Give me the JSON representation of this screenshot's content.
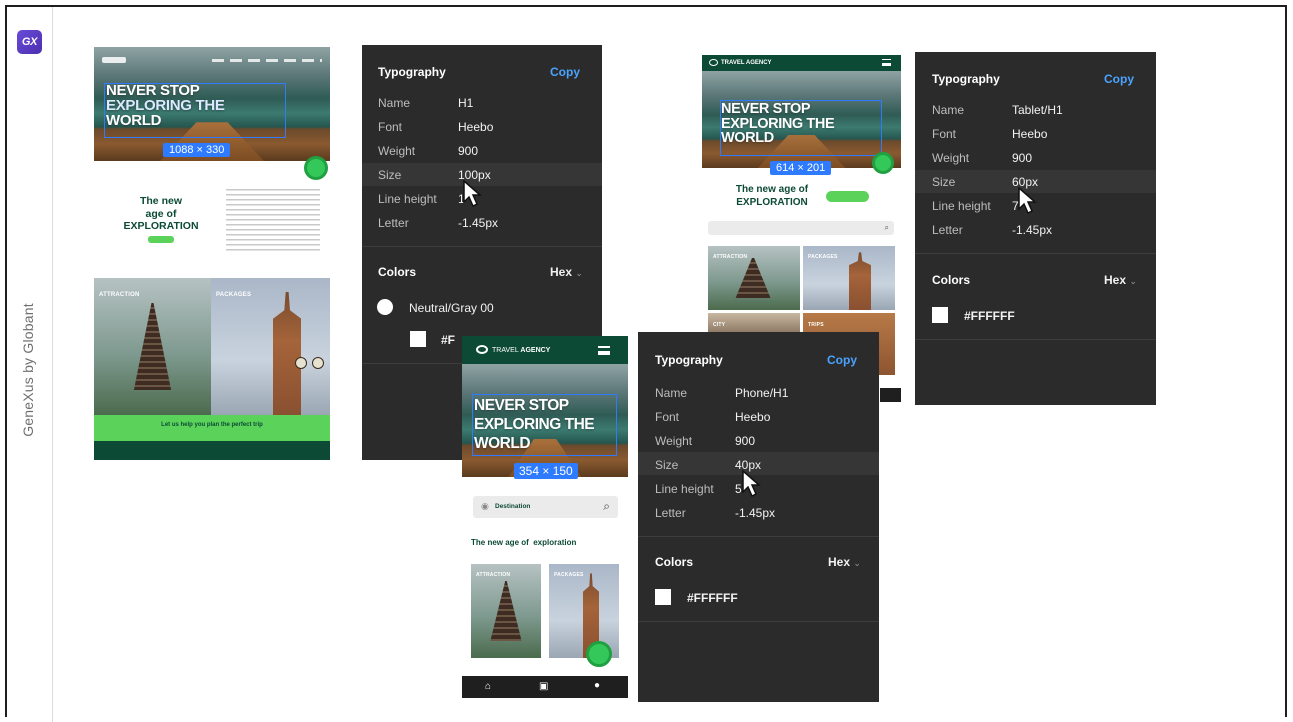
{
  "brand": {
    "logo_text": "GX",
    "vertical_label": "GeneXus by Globant"
  },
  "desktop_mock": {
    "hero_title_line1": "NEVER STOP",
    "hero_title_line2": "EXPLORING THE",
    "hero_title_line3": "WORLD",
    "dimension_badge": "1088 × 330",
    "section_title_line1": "The new",
    "section_title_line2": "age of",
    "section_title_line3": "EXPLORATION",
    "tile_attraction": "ATTRACTION",
    "tile_packages": "PACKAGES",
    "cta_banner": "Let us help you plan the perfect trip"
  },
  "desktop_inspector": {
    "section_typography": "Typography",
    "copy_label": "Copy",
    "rows": [
      {
        "label": "Name",
        "value": "H1"
      },
      {
        "label": "Font",
        "value": "Heebo"
      },
      {
        "label": "Weight",
        "value": "900"
      },
      {
        "label": "Size",
        "value": "100px"
      },
      {
        "label": "Line height",
        "value": "1"
      },
      {
        "label": "Letter",
        "value": "-1.45px"
      }
    ],
    "section_colors": "Colors",
    "format_label": "Hex",
    "color_token": "Neutral/Gray 00",
    "color_hex_partial": "#F"
  },
  "tablet_mock": {
    "app_name": "TRAVEL AGENCY",
    "hero_title_line1": "NEVER STOP",
    "hero_title_line2": "EXPLORING THE",
    "hero_title_line3": "WORLD",
    "dimension_badge": "614 × 201",
    "section_title_line1": "The new age of",
    "section_title_line2": "EXPLORATION",
    "tile_attraction": "ATTRACTION",
    "tile_packages": "PACKAGES",
    "tile_city": "CITY",
    "tile_trips": "TRIPS"
  },
  "tablet_inspector": {
    "section_typography": "Typography",
    "copy_label": "Copy",
    "rows": [
      {
        "label": "Name",
        "value": "Tablet/H1"
      },
      {
        "label": "Font",
        "value": "Heebo"
      },
      {
        "label": "Weight",
        "value": "900"
      },
      {
        "label": "Size",
        "value": "60px"
      },
      {
        "label": "Line height",
        "value": "7"
      },
      {
        "label": "Letter",
        "value": "-1.45px"
      }
    ],
    "section_colors": "Colors",
    "format_label": "Hex",
    "color_hex": "#FFFFFF"
  },
  "phone_mock": {
    "app_name_light": "TRAVEL",
    "app_name_bold": "AGENCY",
    "hero_title_line1": "NEVER STOP",
    "hero_title_line2": "EXPLORING THE",
    "hero_title_line3": "WORLD",
    "dimension_badge": "354 × 150",
    "search_placeholder": "Destination",
    "section_title": "The new age of  exploration",
    "tile_attraction": "ATTRACTION",
    "tile_packages": "PACKAGES"
  },
  "phone_inspector": {
    "section_typography": "Typography",
    "copy_label": "Copy",
    "rows": [
      {
        "label": "Name",
        "value": "Phone/H1"
      },
      {
        "label": "Font",
        "value": "Heebo"
      },
      {
        "label": "Weight",
        "value": "900"
      },
      {
        "label": "Size",
        "value": "40px"
      },
      {
        "label": "Line height",
        "value": "5"
      },
      {
        "label": "Letter",
        "value": "-1.45px"
      }
    ],
    "section_colors": "Colors",
    "format_label": "Hex",
    "color_hex": "#FFFFFF"
  },
  "colors": {
    "panel_bg": "#2b2b2b",
    "accent_copy": "#4aa3ff",
    "selection_blue": "#2f7bff",
    "brand_green": "#0c4a35",
    "cta_green": "#5bd35b"
  }
}
